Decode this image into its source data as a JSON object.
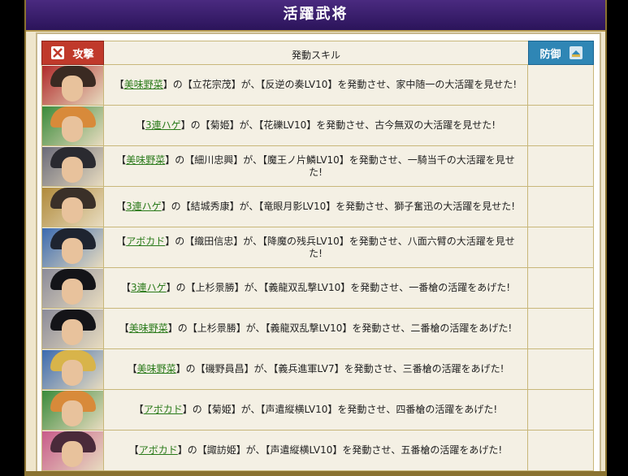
{
  "window": {
    "title": "活躍武将"
  },
  "table": {
    "attack_label": "攻撃",
    "skill_header": "発動スキル",
    "defense_label": "防御"
  },
  "icons": {
    "attack": "swords-icon",
    "defense": "shield-icon"
  },
  "rows": [
    {
      "player": "美味野菜",
      "prefix": "【",
      "middle": "】の【立花宗茂】が、【反逆の奏LV10】を発動させ、家中随一の大活躍を見せた!",
      "portrait": {
        "hair": "#3a2a22",
        "accent": "#b02a2a"
      }
    },
    {
      "player": "3連ハゲ",
      "prefix": "【",
      "middle": "】の【菊姫】が、【花礫LV10】を発動させ、古今無双の大活躍を見せた!",
      "portrait": {
        "hair": "#d88a3a",
        "accent": "#3a8a3a"
      }
    },
    {
      "player": "美味野菜",
      "prefix": "【",
      "middle": "】の【細川忠興】が、【魔王ノ片鱗LV10】を発動させ、一騎当千の大活躍を見せた!",
      "portrait": {
        "hair": "#2a2a30",
        "accent": "#6a6a78"
      }
    },
    {
      "player": "3連ハゲ",
      "prefix": "【",
      "middle": "】の【結城秀康】が、【竜眼月影LV10】を発動させ、獅子奮迅の大活躍を見せた!",
      "portrait": {
        "hair": "#3a3028",
        "accent": "#b08a3a"
      }
    },
    {
      "player": "アボカド",
      "prefix": "【",
      "middle": "】の【織田信忠】が、【降魔の残兵LV10】を発動させ、八面六臂の大活躍を見せた!",
      "portrait": {
        "hair": "#1e2430",
        "accent": "#3a6ab0"
      }
    },
    {
      "player": "3連ハゲ",
      "prefix": "【",
      "middle": "】の【上杉景勝】が、【義龍双乱撃LV10】を発動させ、一番槍の活躍をあげた!",
      "portrait": {
        "hair": "#141418",
        "accent": "#8a8a98"
      }
    },
    {
      "player": "美味野菜",
      "prefix": "【",
      "middle": "】の【上杉景勝】が、【義龍双乱撃LV10】を発動させ、二番槍の活躍をあげた!",
      "portrait": {
        "hair": "#141418",
        "accent": "#8a8a98"
      }
    },
    {
      "player": "美味野菜",
      "prefix": "【",
      "middle": "】の【磯野員昌】が、【義兵進軍LV7】を発動させ、三番槍の活躍をあげた!",
      "portrait": {
        "hair": "#d8b44a",
        "accent": "#3a6ab0"
      }
    },
    {
      "player": "アボカド",
      "prefix": "【",
      "middle": "】の【菊姫】が、【声遣縦横LV10】を発動させ、四番槍の活躍をあげた!",
      "portrait": {
        "hair": "#d88a3a",
        "accent": "#3a8a3a"
      }
    },
    {
      "player": "アボカド",
      "prefix": "【",
      "middle": "】の【諏訪姫】が、【声遣縦横LV10】を発動させ、五番槍の活躍をあげた!",
      "portrait": {
        "hair": "#4a2a3a",
        "accent": "#c85a8a"
      }
    }
  ]
}
